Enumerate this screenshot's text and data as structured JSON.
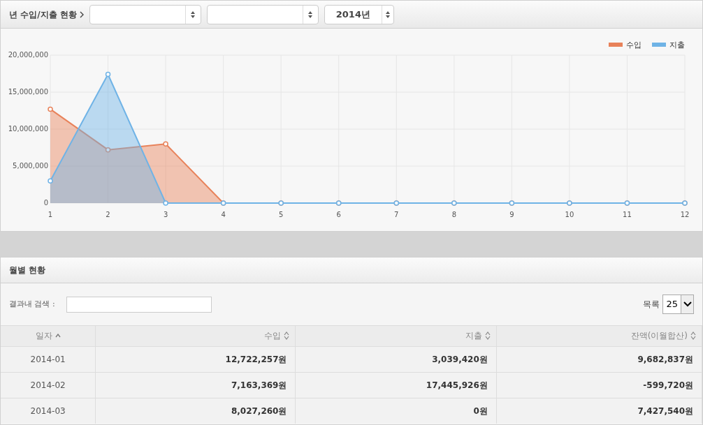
{
  "toolbar": {
    "title": "년 수입/지출 현황",
    "selects": [
      {
        "kind": "select"
      },
      {
        "kind": "select"
      },
      {
        "kind": "select",
        "value": "2014년"
      }
    ]
  },
  "chart": {
    "chart_data": {
      "type": "area",
      "grid": true,
      "legend": true,
      "x": [
        "1",
        "2",
        "3",
        "4",
        "5",
        "6",
        "7",
        "8",
        "9",
        "10",
        "11",
        "12"
      ],
      "ylim": [
        0,
        20000000
      ],
      "yticks": [
        {
          "value": 0,
          "label": "0"
        },
        {
          "value": 5000000,
          "label": "5,000,000"
        },
        {
          "value": 10000000,
          "label": "10,000,000"
        },
        {
          "value": 15000000,
          "label": "15,000,000"
        },
        {
          "value": 20000000,
          "label": "20,000,000"
        }
      ],
      "series": [
        {
          "name": "수입",
          "color": "#e8825a",
          "values": [
            12700000,
            7200000,
            8000000,
            0,
            0,
            0,
            0,
            0,
            0,
            0,
            0,
            0
          ]
        },
        {
          "name": "지출",
          "color": "#6fb3e6",
          "values": [
            3000000,
            17400000,
            0,
            0,
            0,
            0,
            0,
            0,
            0,
            0,
            0,
            0
          ]
        }
      ]
    }
  },
  "monthly": {
    "title": "월별 현황",
    "search_label": "결과내 검색 :",
    "page_size_label": "목록",
    "page_size": "25",
    "columns": [
      {
        "label": "일자",
        "kind": "date",
        "sorted": true
      },
      {
        "label": "수입",
        "kind": "amount",
        "sorted": false
      },
      {
        "label": "지출",
        "kind": "amount",
        "sorted": false
      },
      {
        "label": "잔액(이월합산)",
        "kind": "amount",
        "sorted": false
      }
    ],
    "rows": [
      [
        "2014-01",
        "12,722,257원",
        "3,039,420원",
        "9,682,837원"
      ],
      [
        "2014-02",
        "7,163,369원",
        "17,445,926원",
        "-599,720원"
      ],
      [
        "2014-03",
        "8,027,260원",
        "0원",
        "7,427,540원"
      ]
    ]
  }
}
